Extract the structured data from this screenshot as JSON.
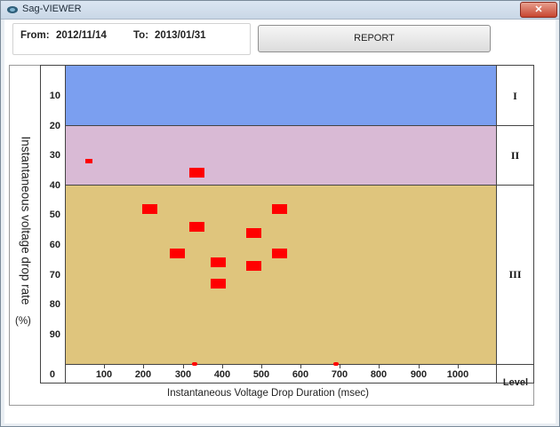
{
  "window": {
    "title": "Sag-VIEWER",
    "close_label": "✕"
  },
  "header": {
    "from_label": "From:",
    "from_value": "2012/11/14",
    "to_label": "To:",
    "to_value": "2013/01/31",
    "report_button": "REPORT"
  },
  "chart_data": {
    "type": "scatter",
    "xlabel": "Instantaneous Voltage Drop Duration (msec)",
    "ylabel": "Instantaneous voltage drop rate",
    "ylabel_unit": "(%)",
    "x_ticks": [
      "0",
      "100",
      "200",
      "300",
      "400",
      "500",
      "600",
      "700",
      "800",
      "900",
      "1000"
    ],
    "y_ticks": [
      "10",
      "20",
      "30",
      "40",
      "50",
      "60",
      "70",
      "80",
      "90",
      "0"
    ],
    "xlim": [
      0,
      1100
    ],
    "ylim": [
      0,
      100
    ],
    "y_inverted": true,
    "levels": [
      {
        "label": "I",
        "from": 0,
        "to": 20,
        "color": "#7b9ff0"
      },
      {
        "label": "II",
        "from": 20,
        "to": 40,
        "color": "#d9bad5"
      },
      {
        "label": "III",
        "from": 40,
        "to": 100,
        "color": "#dfc57d"
      }
    ],
    "level_header": "Level",
    "point_color": "#ff0000",
    "points": [
      {
        "x": 60,
        "y": 32,
        "size": "small"
      },
      {
        "x": 335,
        "y": 36,
        "size": "big"
      },
      {
        "x": 215,
        "y": 48,
        "size": "big"
      },
      {
        "x": 335,
        "y": 54,
        "size": "big"
      },
      {
        "x": 545,
        "y": 48,
        "size": "big"
      },
      {
        "x": 480,
        "y": 56,
        "size": "big"
      },
      {
        "x": 285,
        "y": 63,
        "size": "big"
      },
      {
        "x": 545,
        "y": 63,
        "size": "big"
      },
      {
        "x": 390,
        "y": 66,
        "size": "big"
      },
      {
        "x": 480,
        "y": 67,
        "size": "big"
      },
      {
        "x": 390,
        "y": 73,
        "size": "big"
      },
      {
        "x": 330,
        "y": 100,
        "size": "tiny"
      },
      {
        "x": 690,
        "y": 100,
        "size": "tiny"
      }
    ]
  }
}
